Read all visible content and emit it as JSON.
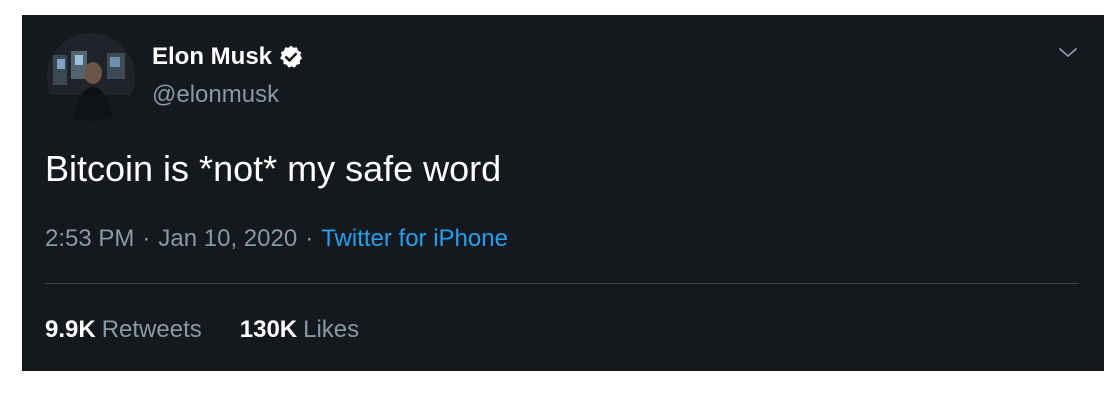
{
  "author": {
    "display_name": "Elon Musk",
    "handle": "@elonmusk",
    "verified": true
  },
  "tweet": {
    "text": "Bitcoin is *not* my safe word",
    "time": "2:53 PM",
    "separator": "·",
    "date": "Jan 10, 2020",
    "source": "Twitter for iPhone"
  },
  "stats": {
    "retweets_count": "9.9K",
    "retweets_label": "Retweets",
    "likes_count": "130K",
    "likes_label": "Likes"
  },
  "icons": {
    "verified": "verified-badge-icon",
    "menu": "chevron-down-icon"
  },
  "colors": {
    "background": "#15181c",
    "primary_text": "#ffffff",
    "secondary_text": "#8899a6",
    "link": "#1da1f2",
    "divider": "#38444d"
  }
}
